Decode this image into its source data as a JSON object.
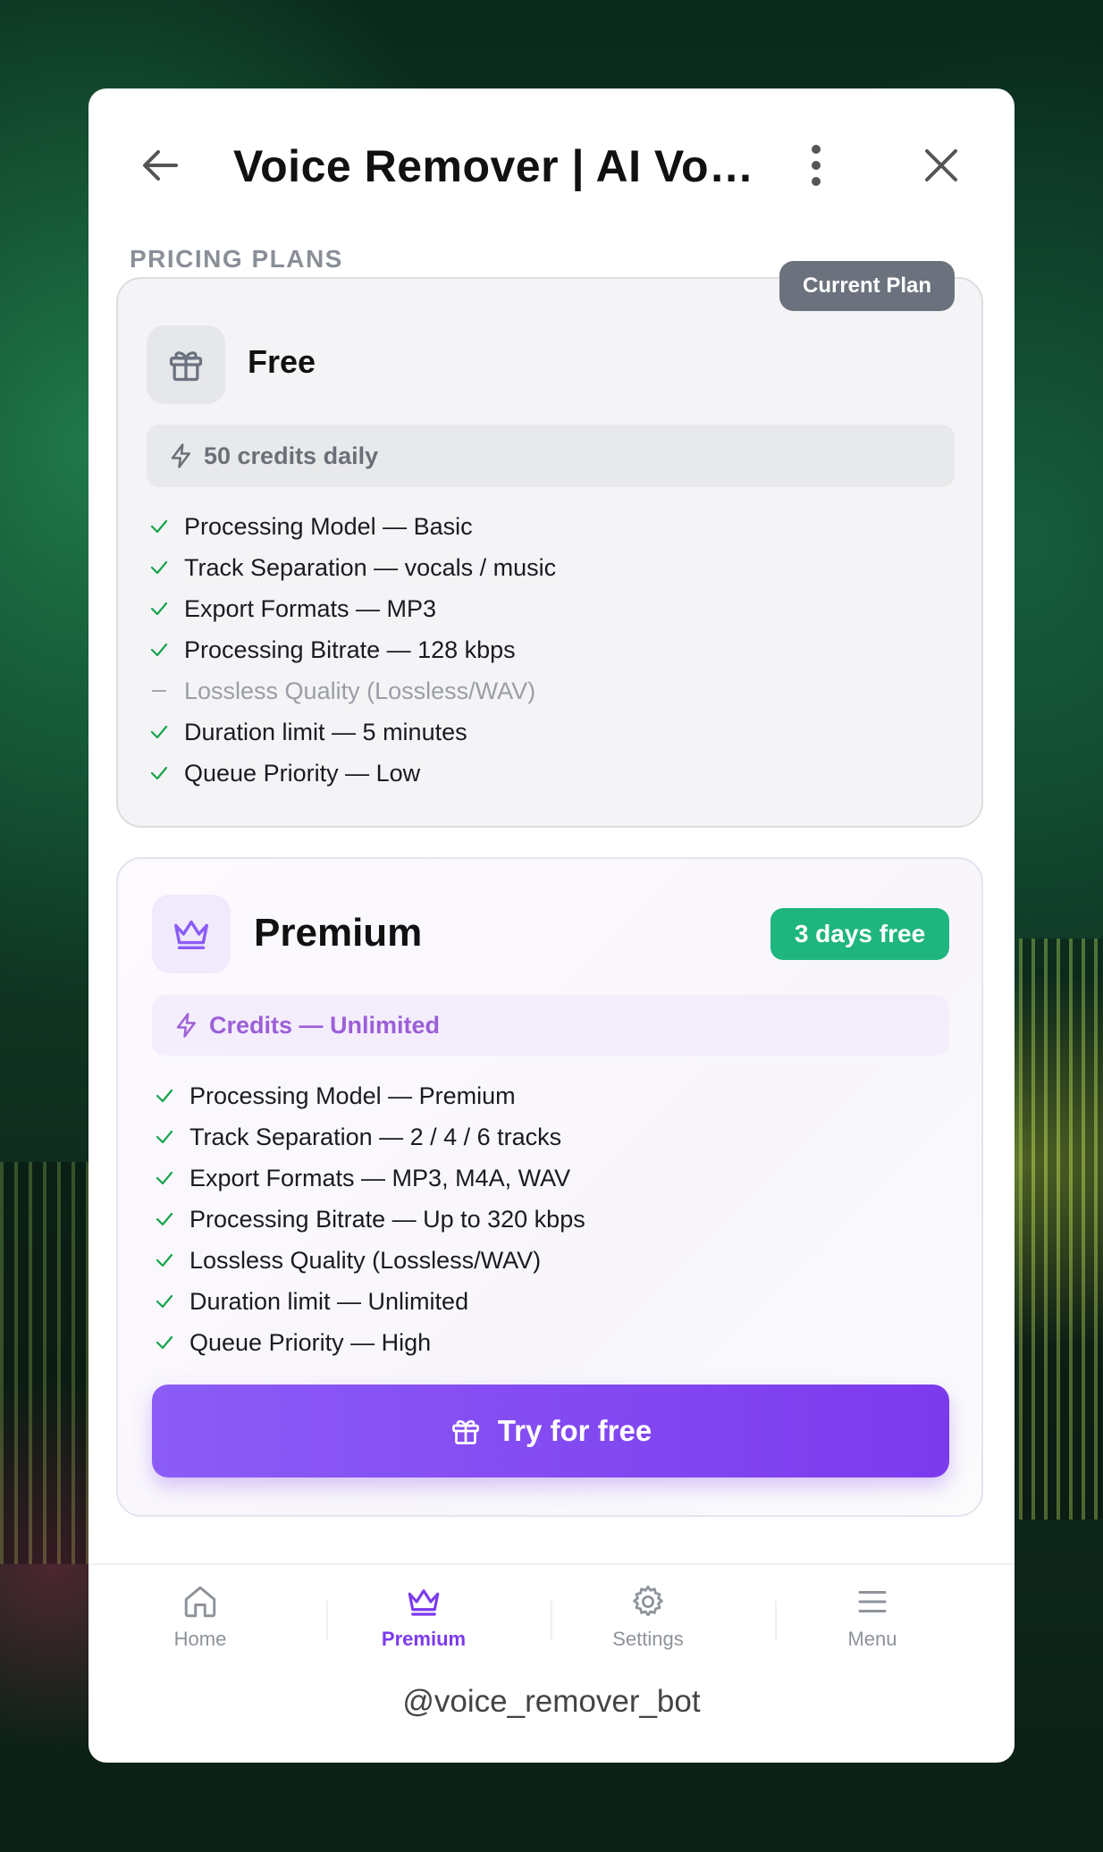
{
  "header": {
    "title": "Voice Remover | AI Voc...",
    "back_icon": "arrow-left-icon",
    "more_icon": "more-vertical-icon",
    "close_icon": "close-icon"
  },
  "section_label": "PRICING PLANS",
  "free_plan": {
    "badge": "Current Plan",
    "name": "Free",
    "icon": "gift-icon",
    "credits": "50 credits daily",
    "features": [
      {
        "text": "Processing Model — Basic",
        "included": true
      },
      {
        "text": "Track Separation — vocals / music",
        "included": true
      },
      {
        "text": "Export Formats — MP3",
        "included": true
      },
      {
        "text": "Processing Bitrate — 128 kbps",
        "included": true
      },
      {
        "text": "Lossless Quality (Lossless/WAV)",
        "included": false
      },
      {
        "text": "Duration limit — 5 minutes",
        "included": true
      },
      {
        "text": "Queue Priority — Low",
        "included": true
      }
    ]
  },
  "premium_plan": {
    "badge": "3 days free",
    "name": "Premium",
    "icon": "crown-icon",
    "credits": "Credits — Unlimited",
    "features": [
      {
        "text": "Processing Model — Premium",
        "included": true
      },
      {
        "text": "Track Separation — 2 / 4 / 6 tracks",
        "included": true
      },
      {
        "text": "Export Formats — MP3, M4A, WAV",
        "included": true
      },
      {
        "text": "Processing Bitrate — Up to 320 kbps",
        "included": true
      },
      {
        "text": "Lossless Quality (Lossless/WAV)",
        "included": true
      },
      {
        "text": "Duration limit — Unlimited",
        "included": true
      },
      {
        "text": "Queue Priority — High",
        "included": true
      }
    ],
    "cta_label": "Try for free"
  },
  "tabs": [
    {
      "label": "Home",
      "icon": "home-icon",
      "active": false
    },
    {
      "label": "Premium",
      "icon": "crown-icon",
      "active": true
    },
    {
      "label": "Settings",
      "icon": "gear-icon",
      "active": false
    },
    {
      "label": "Menu",
      "icon": "menu-icon",
      "active": false
    }
  ],
  "footer": {
    "handle": "@voice_remover_bot"
  },
  "colors": {
    "accent": "#7c3aed",
    "trial_badge": "#1fb57e",
    "current_badge": "#6b727d",
    "check": "#16a34a"
  }
}
